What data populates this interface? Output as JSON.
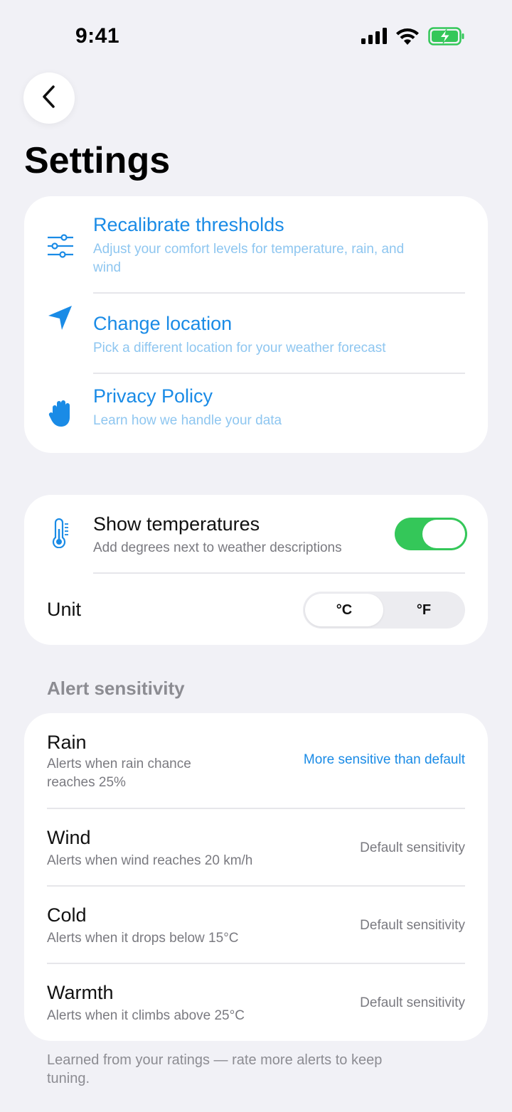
{
  "status_bar": {
    "time": "9:41",
    "battery_color": "#34c759"
  },
  "nav": {
    "back_icon": "chevron-left-icon"
  },
  "page": {
    "title": "Settings"
  },
  "links": [
    {
      "icon": "sliders-icon",
      "title": "Recalibrate thresholds",
      "subtitle": "Adjust your comfort levels for temperature, rain, and wind"
    },
    {
      "icon": "location-arrow-icon",
      "title": "Change location",
      "subtitle": "Pick a different location for your weather forecast"
    },
    {
      "icon": "hand-icon",
      "title": "Privacy Policy",
      "subtitle": "Learn how we handle your data"
    }
  ],
  "temperature": {
    "icon": "thermometer-icon",
    "title": "Show temperatures",
    "subtitle": "Add degrees next to weather descriptions",
    "toggle_on": true,
    "unit_label": "Unit",
    "unit_options": [
      "°C",
      "°F"
    ],
    "unit_selected": "°C"
  },
  "alerts": {
    "section_label": "Alert sensitivity",
    "items": [
      {
        "title": "Rain",
        "subtitle": "Alerts when rain chance reaches 25%",
        "status": "More sensitive than default"
      },
      {
        "title": "Wind",
        "subtitle": "Alerts when wind reaches 20 km/h",
        "status": "Default sensitivity"
      },
      {
        "title": "Cold",
        "subtitle": "Alerts when it drops below 15°C",
        "status": "Default sensitivity"
      },
      {
        "title": "Warmth",
        "subtitle": "Alerts when it climbs above 25°C",
        "status": "Default sensitivity"
      }
    ],
    "footer": "Learned from your ratings — rate more alerts to keep tuning."
  },
  "colors": {
    "accent": "#1a8be6",
    "accent_light": "#8ec6f0",
    "toggle_on": "#34c759",
    "background": "#f1f1f6"
  }
}
